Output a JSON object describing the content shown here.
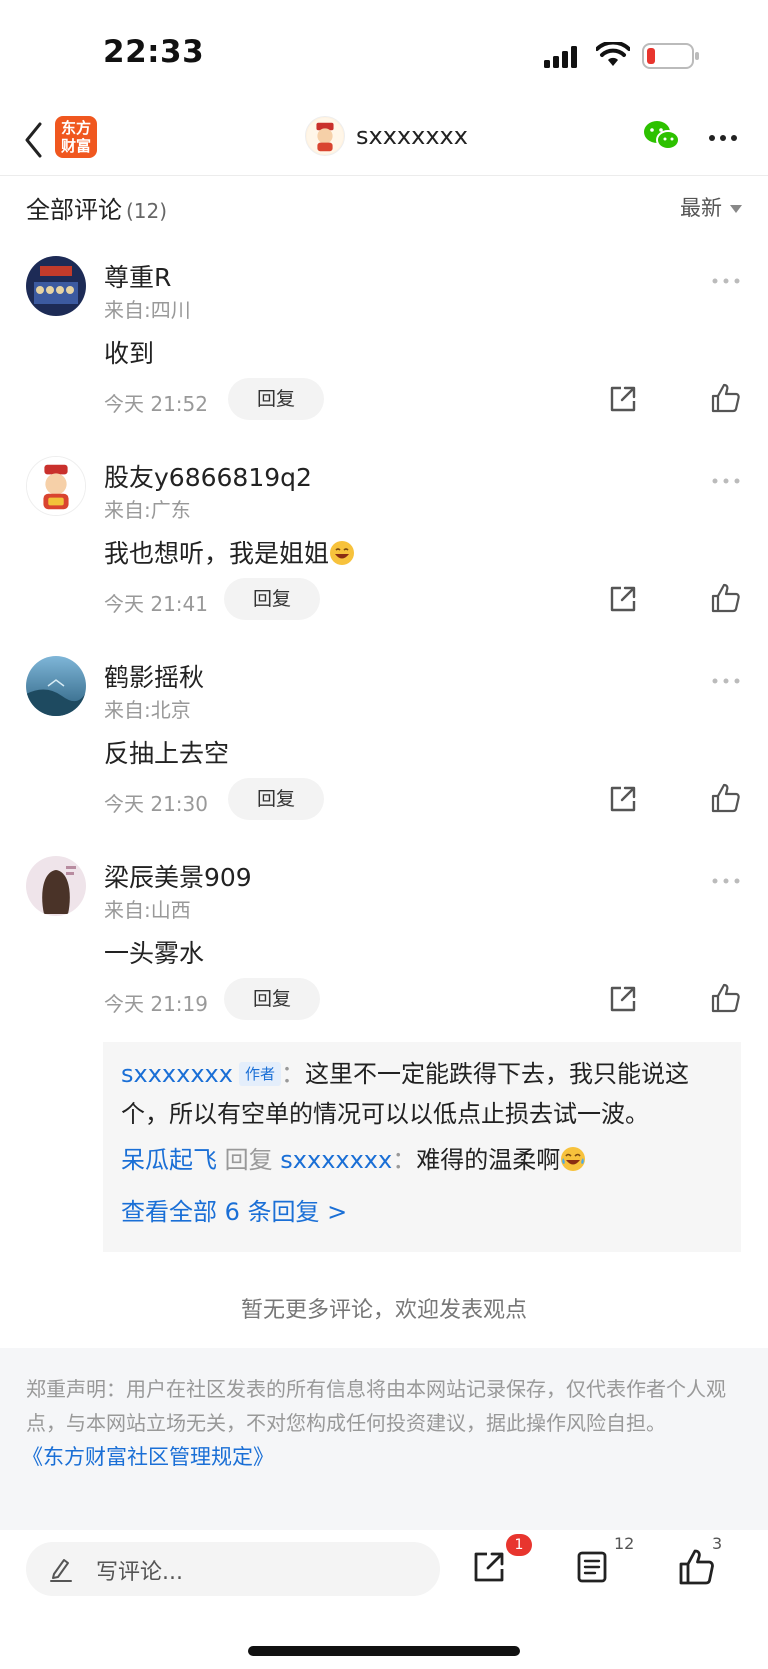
{
  "status_bar": {
    "time": "22:33"
  },
  "nav": {
    "brand_logo_line1": "东方",
    "brand_logo_line2": "财富",
    "title": "sxxxxxxx"
  },
  "comments_header": {
    "title": "全部评论",
    "count": "(12)",
    "sort_label": "最新"
  },
  "comments": [
    {
      "username": "尊重R",
      "location": "来自:四川",
      "content": "收到",
      "time": "今天 21:52",
      "reply_label": "回复"
    },
    {
      "username": "股友y6866819q2",
      "location": "来自:广东",
      "content": "我也想听，我是姐姐",
      "time": "今天 21:41",
      "reply_label": "回复"
    },
    {
      "username": "鹤影摇秋",
      "location": "来自:北京",
      "content": "反抽上去空",
      "time": "今天 21:30",
      "reply_label": "回复"
    },
    {
      "username": "梁辰美景909",
      "location": "来自:山西",
      "content": "一头雾水",
      "time": "今天 21:19",
      "reply_label": "回复"
    }
  ],
  "reply_thread": {
    "reply1_user": "sxxxxxxx",
    "reply1_badge": "作者",
    "reply1_sep": "：",
    "reply1_text_line1": "这里不一定能跌得下去，我只能说这",
    "reply1_text_line2": "个，所以有空单的情况可以以低点止损去试一波。",
    "reply2_user": "呆瓜起飞",
    "reply2_action": "回复",
    "reply2_target": "sxxxxxxx",
    "reply2_sep": "：",
    "reply2_text": "难得的温柔啊",
    "view_all": "查看全部 6 条回复 >"
  },
  "no_more": "暂无更多评论，欢迎发表观点",
  "disclaimer": {
    "text": "郑重声明：用户在社区发表的所有信息将由本网站记录保存，仅代表作者个人观点，与本网站立场无关，不对您构成任何投资建议，据此操作风险自担。",
    "link": "《东方财富社区管理规定》"
  },
  "bottom_bar": {
    "input_placeholder": "写评论...",
    "share_badge": "1",
    "comment_count": "12",
    "like_count": "3"
  },
  "colors": {
    "brand": "#f0571f",
    "link": "#1a6fd6",
    "badge": "#e8352e",
    "wechat": "#2dc100"
  }
}
